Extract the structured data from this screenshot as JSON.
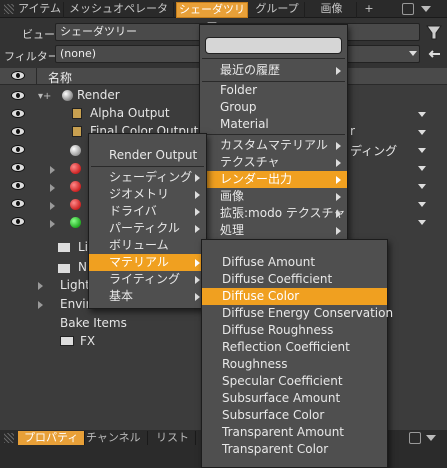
{
  "tabs": [
    {
      "label": "アイテム",
      "active": false
    },
    {
      "label": "メッシュオペレータ",
      "active": false
    },
    {
      "label": "シェーダツリー",
      "active": true
    },
    {
      "label": "グループ",
      "active": false
    },
    {
      "label": "画像",
      "active": false
    },
    {
      "label": "+",
      "active": false
    }
  ],
  "view": {
    "label": "ビュー",
    "value": "シェーダツリー"
  },
  "filter": {
    "label": "フィルター",
    "value": "(none)"
  },
  "tree": {
    "header_name": "名称",
    "rows": [
      {
        "label": "Render"
      },
      {
        "label": "Alpha Output"
      },
      {
        "label": "Final Color Output"
      },
      {
        "label": "Li"
      },
      {
        "label": "N"
      },
      {
        "label": "Light"
      },
      {
        "label": "Envir"
      },
      {
        "label": "Bake Items"
      },
      {
        "label": "FX"
      }
    ],
    "right_fragments": [
      "r",
      "ディング"
    ]
  },
  "menu1": {
    "search_placeholder": "",
    "items": [
      {
        "label": "最近の履歴",
        "sub": true
      },
      {
        "label": "Folder",
        "sub": false
      },
      {
        "label": "Group",
        "sub": false
      },
      {
        "label": "Material",
        "sub": false
      },
      {
        "label": "カスタムマテリアル",
        "sub": true
      },
      {
        "label": "テクスチャ",
        "sub": true
      },
      {
        "label": "レンダー出力",
        "sub": true,
        "highlight": true
      },
      {
        "label": "画像",
        "sub": true
      },
      {
        "label": "拡張:modo テクスチャ",
        "sub": true
      },
      {
        "label": "処理",
        "sub": true
      }
    ]
  },
  "menu2": {
    "items": [
      {
        "label": "Render Output",
        "sub": false
      },
      {
        "label": "シェーディング",
        "sub": true
      },
      {
        "label": "ジオメトリ",
        "sub": true
      },
      {
        "label": "ドライバ",
        "sub": true
      },
      {
        "label": "パーティクル",
        "sub": true
      },
      {
        "label": "ボリューム",
        "sub": false
      },
      {
        "label": "マテリアル",
        "sub": true,
        "highlight": true
      },
      {
        "label": "ライティング",
        "sub": true
      },
      {
        "label": "基本",
        "sub": true
      }
    ]
  },
  "menu3": {
    "items": [
      {
        "label": "Diffuse Amount"
      },
      {
        "label": "Diffuse Coefficient"
      },
      {
        "label": "Diffuse Color",
        "highlight": true
      },
      {
        "label": "Diffuse Energy Conservation"
      },
      {
        "label": "Diffuse Roughness"
      },
      {
        "label": "Reflection Coefficient"
      },
      {
        "label": "Roughness"
      },
      {
        "label": "Specular Coefficient"
      },
      {
        "label": "Subsurface Amount"
      },
      {
        "label": "Subsurface Color"
      },
      {
        "label": "Transparent Amount"
      },
      {
        "label": "Transparent Color"
      }
    ]
  },
  "bottom_tabs": [
    {
      "label": "プロパティ",
      "active": true
    },
    {
      "label": "チャンネル",
      "active": false
    },
    {
      "label": "リスト",
      "active": false
    }
  ],
  "colors": {
    "accent": "#f0a020",
    "panel": "#3c3c3c",
    "menu": "#4f4f4f"
  }
}
